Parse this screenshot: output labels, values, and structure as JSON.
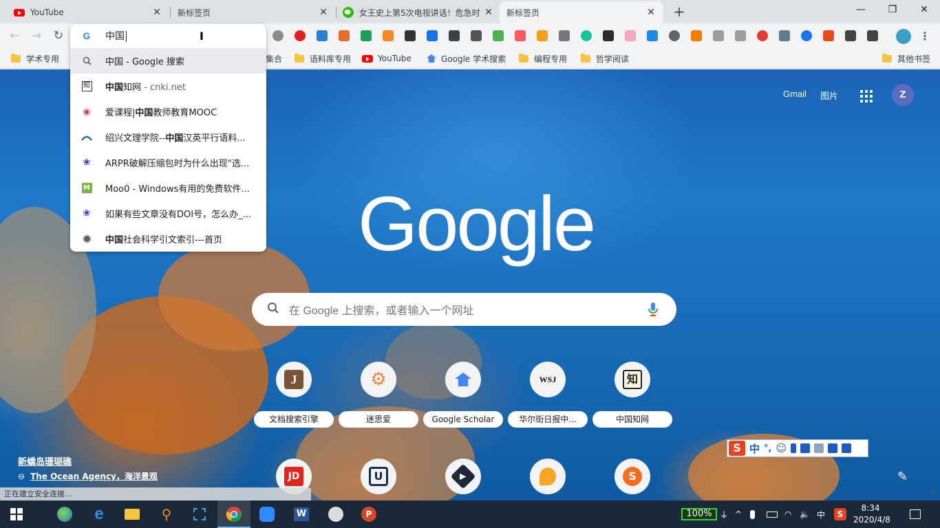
{
  "tabs": [
    {
      "title": "YouTube",
      "favicon": "youtube-icon"
    },
    {
      "title": "新标签页",
      "favicon": "none"
    },
    {
      "title": "女王史上第5次电视讲话！危急时",
      "favicon": "wechat-icon"
    },
    {
      "title": "新标签页",
      "favicon": "none",
      "active": true
    }
  ],
  "window_controls": {
    "minimize": "—",
    "maximize": "❐",
    "close": "✕"
  },
  "omnibox": {
    "text": "中国",
    "suggestions": [
      {
        "bold": "",
        "text": "中国 - Google 搜索",
        "url": "",
        "icon": "search-icon",
        "selected": true
      },
      {
        "bold": "中国",
        "text": "知网",
        "url": " - cnki.net",
        "icon": "cnki-icon"
      },
      {
        "bold": "",
        "text": "爱课程|",
        "bold2": "中国",
        "text2": "教师教育MOOC",
        "url": "",
        "icon": "icourse-icon"
      },
      {
        "bold": "",
        "text": "绍兴文理学院--",
        "bold2": "中国",
        "text2": "汉英平行语料...",
        "url": "",
        "icon": "usx-icon"
      },
      {
        "bold": "",
        "text": "ARPR破解压缩包时为什么出现\"选...",
        "url": "",
        "icon": "baidu-paw-icon"
      },
      {
        "bold": "",
        "text": "Moo0 - Windows有用的免费软件...",
        "url": "",
        "icon": "moo0-icon"
      },
      {
        "bold": "",
        "text": "如果有些文章没有DOI号，怎么办_...",
        "url": "",
        "icon": "baidu-paw-icon"
      },
      {
        "bold": "中国",
        "text": "社会科学引文索引---首页",
        "url": "",
        "icon": "cssci-icon"
      }
    ]
  },
  "bookmarks": [
    {
      "label": "学术专用",
      "type": "folder"
    },
    {
      "label": "集合",
      "type": "folder"
    },
    {
      "label": "语料库专用",
      "type": "folder"
    },
    {
      "label": "YouTube",
      "type": "youtube"
    },
    {
      "label": "Google 学术搜索",
      "type": "scholar"
    },
    {
      "label": "编程专用",
      "type": "folder"
    },
    {
      "label": "哲学阅读",
      "type": "folder"
    },
    {
      "label": "其他书签",
      "type": "folder"
    }
  ],
  "header": {
    "gmail": "Gmail",
    "images": "图片",
    "avatar_letter": "Z"
  },
  "logo": "Google",
  "search": {
    "placeholder": "在 Google 上搜索，或者输入一个网址"
  },
  "shortcuts": [
    {
      "label": "文档搜索引擎",
      "icon": "j-icon"
    },
    {
      "label": "迷思爱",
      "icon": "gear-icon"
    },
    {
      "label": "Google Scholar",
      "icon": "scholar-icon"
    },
    {
      "label": "华尔街日报中...",
      "icon": "wsj-icon"
    },
    {
      "label": "中国知网",
      "icon": "cnki-icon"
    }
  ],
  "shortcuts_row2": [
    {
      "icon": "jd-icon",
      "text": "JD"
    },
    {
      "icon": "u-icon",
      "text": "U"
    },
    {
      "icon": "play-icon",
      "text": "▶"
    },
    {
      "icon": "bubble-icon",
      "text": ""
    },
    {
      "icon": "sogou-icon",
      "text": "S"
    }
  ],
  "background_credit": {
    "title": "新蟜岛珊瑚礁",
    "source": "The Ocean Agency，海洋景观"
  },
  "status_text": "正在建立安全连接...",
  "ime": {
    "logo": "S",
    "mode": "中",
    "punct": "°,"
  },
  "tray": {
    "battery": "100%",
    "input_lang": "中"
  },
  "clock": {
    "time": "8:34",
    "date": "2020/4/8"
  },
  "colors": {
    "accent": "#1a73e8",
    "tab_bg": "#dee1e6",
    "taskbar": "#1b2838"
  }
}
